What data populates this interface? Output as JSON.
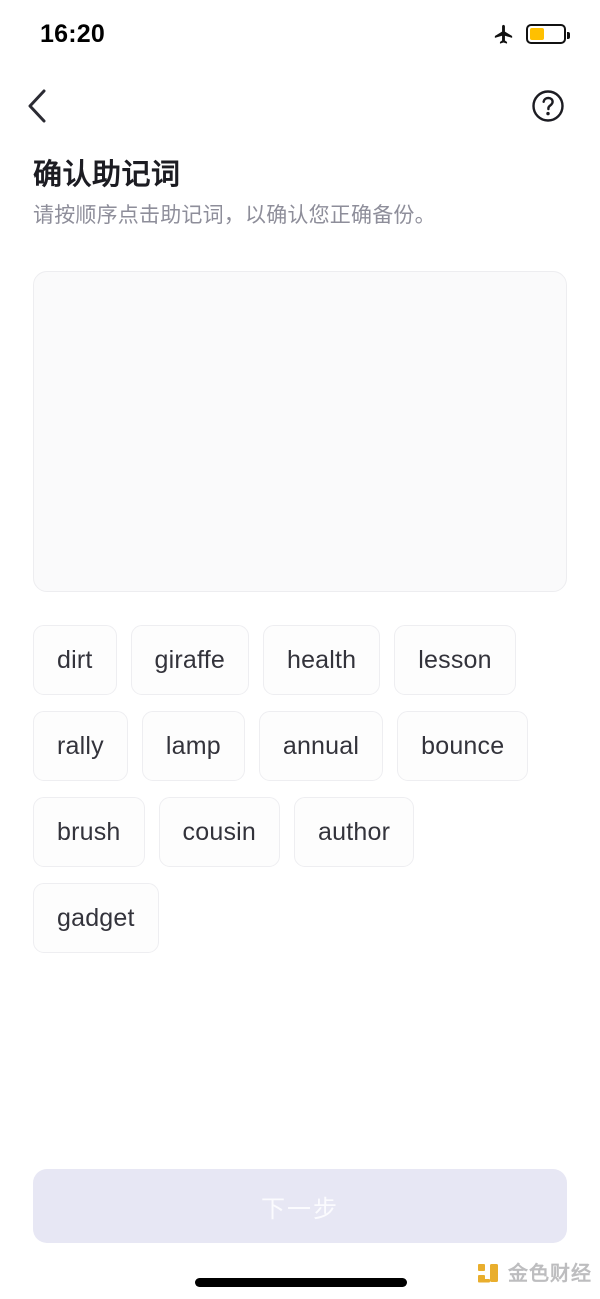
{
  "status_bar": {
    "time": "16:20",
    "airplane_icon": "airplane-mode-icon",
    "battery_icon": "battery-low-power-icon",
    "battery_level_percent": 45,
    "battery_color": "#FFC000"
  },
  "nav": {
    "back_icon": "chevron-left-icon",
    "help_icon": "question-mark-circle-icon"
  },
  "header": {
    "title": "确认助记词",
    "subtitle": "请按顺序点击助记词，以确认您正确备份。"
  },
  "answer_panel": {
    "selected_words": [],
    "background_color": "#FAFAFB",
    "border_color": "#EDEDF0"
  },
  "word_bank": {
    "words": [
      "dirt",
      "giraffe",
      "health",
      "lesson",
      "rally",
      "lamp",
      "annual",
      "bounce",
      "brush",
      "cousin",
      "author",
      "gadget"
    ]
  },
  "footer": {
    "next_label": "下一步",
    "next_enabled": false,
    "next_background_color": "#E7E7F4",
    "next_text_color": "#FBFBFE"
  },
  "watermark": {
    "text": "金色财经",
    "logo_icon": "jinse-finance-logo-icon",
    "logo_color": "#E8A81E",
    "text_color": "#B9B9BB"
  }
}
